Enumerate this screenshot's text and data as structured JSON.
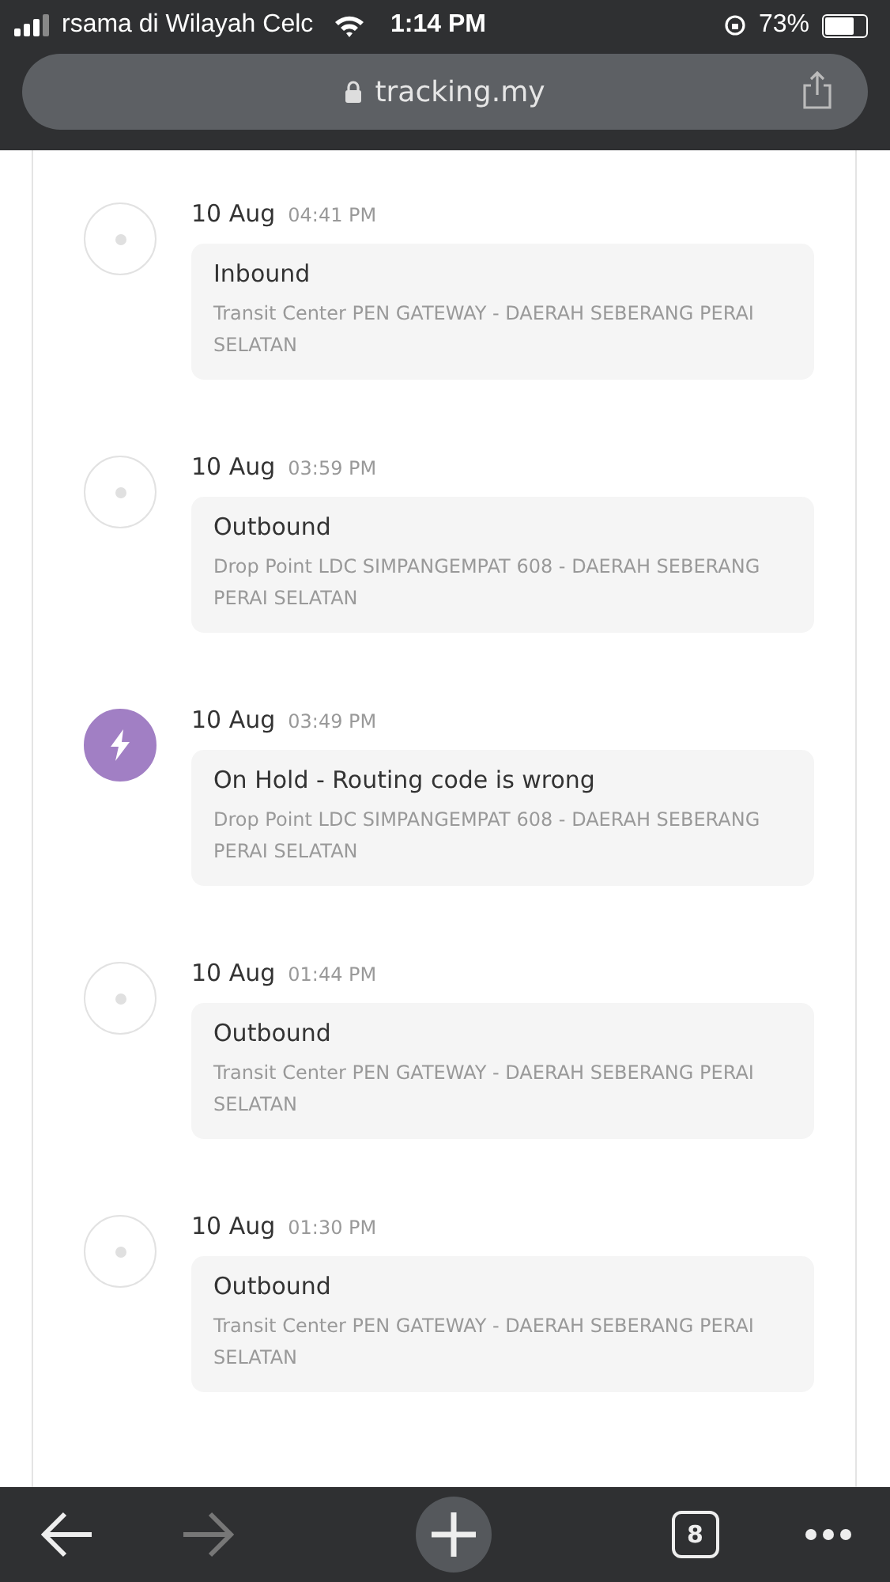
{
  "status_bar": {
    "carrier": "rsama di Wilayah Celc",
    "time": "1:14 PM",
    "battery": {
      "text": "73%",
      "level": 0.73
    }
  },
  "address_bar": {
    "url": "tracking.my"
  },
  "events": [
    {
      "kind": "normal",
      "date": "10 Aug",
      "time": "04:41 PM",
      "title": "Inbound",
      "location": "Transit Center PEN GATEWAY - DAERAH SEBERANG PERAI SELATAN"
    },
    {
      "kind": "normal",
      "date": "10 Aug",
      "time": "03:59 PM",
      "title": "Outbound",
      "location": "Drop Point LDC SIMPANGEMPAT 608 - DAERAH SEBERANG PERAI SELATAN"
    },
    {
      "kind": "hold",
      "date": "10 Aug",
      "time": "03:49 PM",
      "title": "On Hold - Routing code is wrong",
      "location": "Drop Point LDC SIMPANGEMPAT 608 - DAERAH SEBERANG PERAI SELATAN"
    },
    {
      "kind": "normal",
      "date": "10 Aug",
      "time": "01:44 PM",
      "title": "Outbound",
      "location": "Transit Center PEN GATEWAY - DAERAH SEBERANG PERAI SELATAN"
    },
    {
      "kind": "normal",
      "date": "10 Aug",
      "time": "01:30 PM",
      "title": "Outbound",
      "location": "Transit Center PEN GATEWAY - DAERAH SEBERANG PERAI SELATAN"
    }
  ],
  "toolbar": {
    "tab_count": "8",
    "forward_disabled": true
  }
}
